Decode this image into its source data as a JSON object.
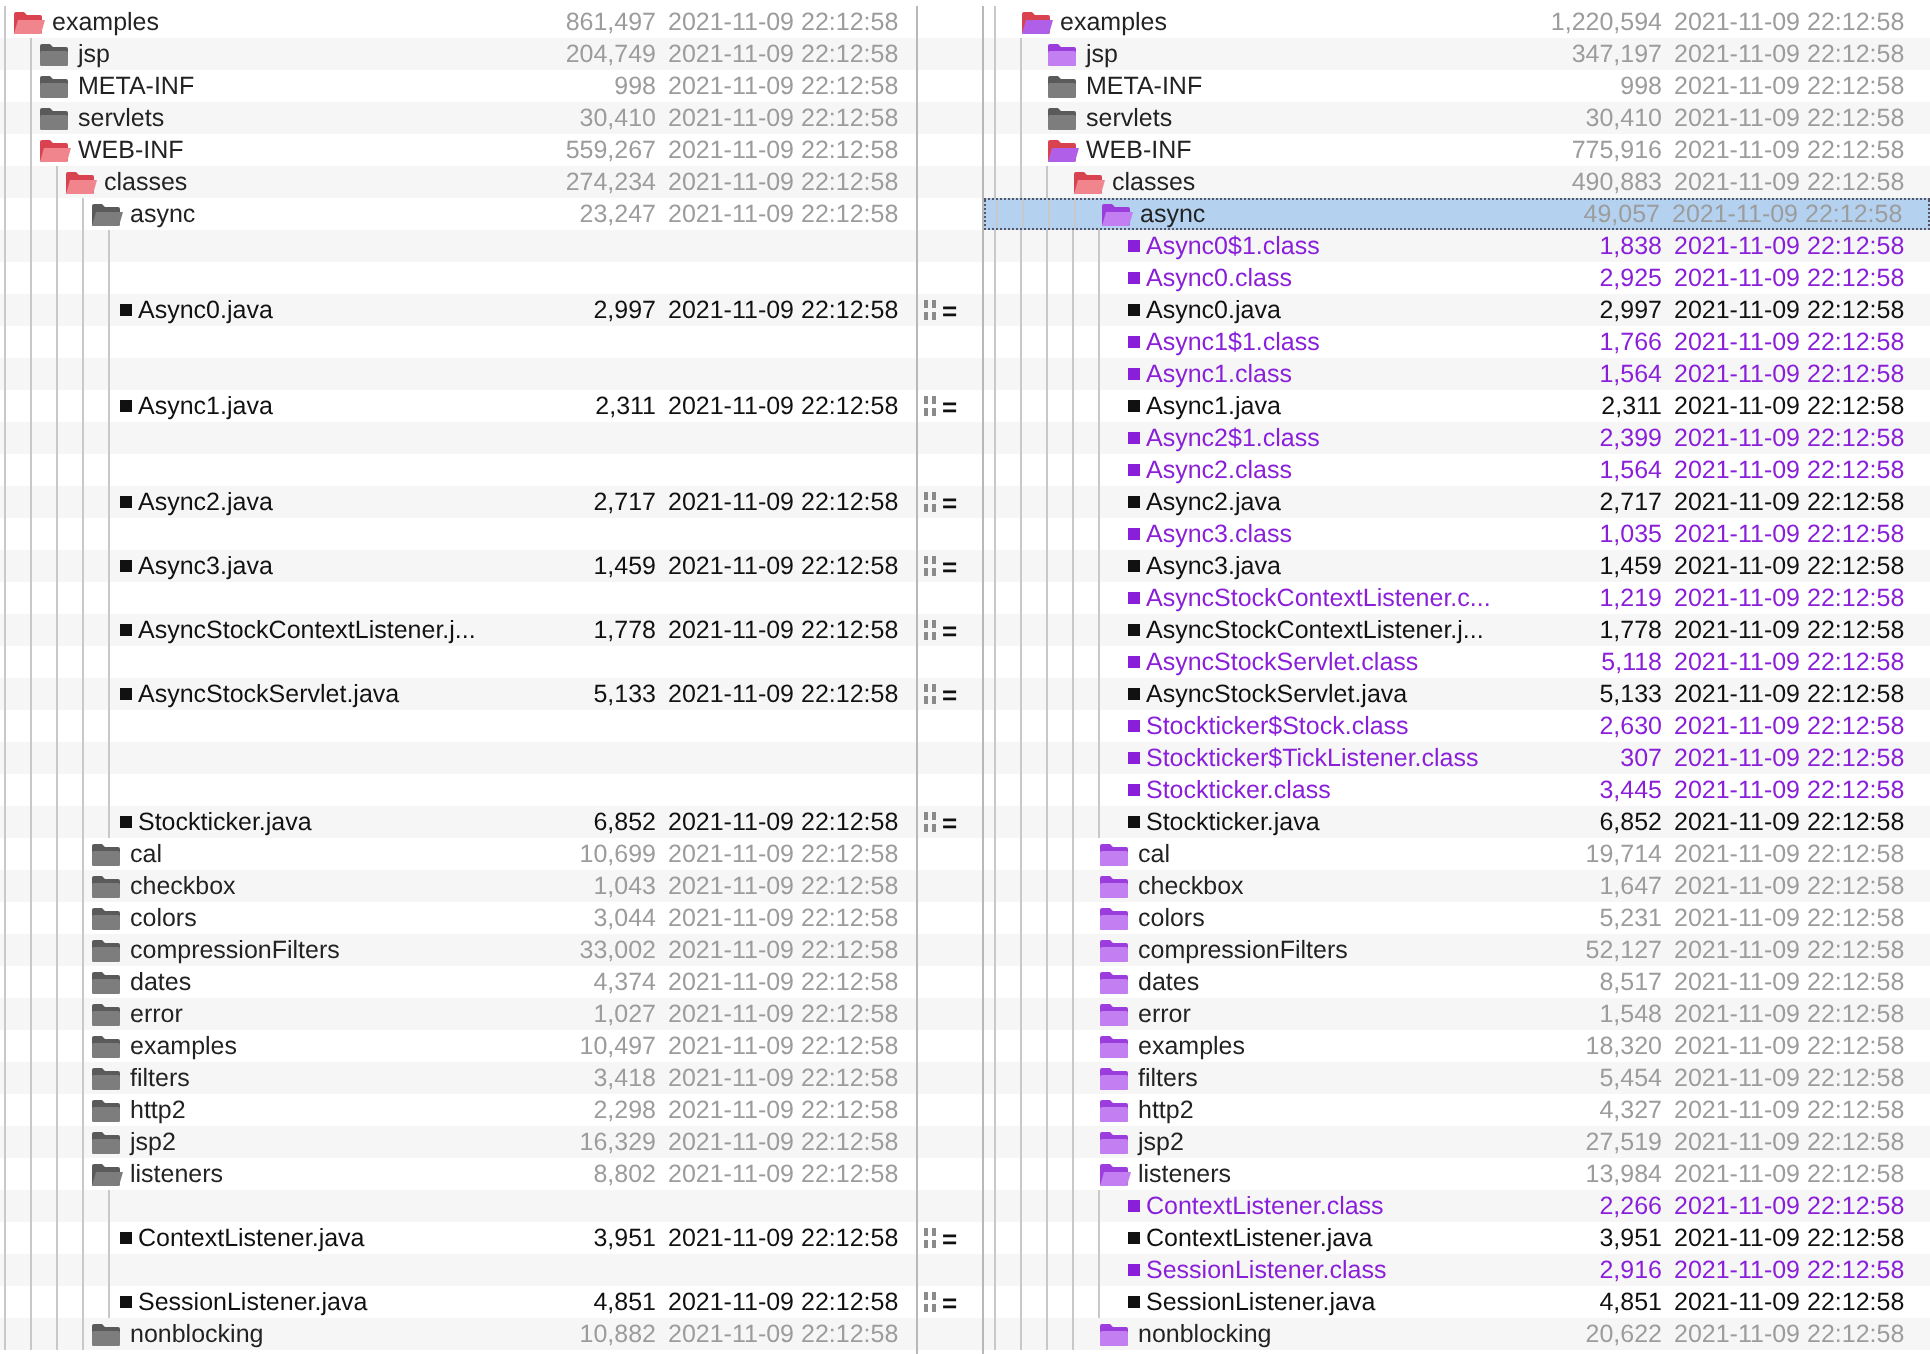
{
  "rows": [
    {
      "selected": false,
      "left": {
        "name": "examples",
        "size": "861,497",
        "date": "2021-11-09 22:12:58",
        "kind": "folder",
        "changed": true,
        "orphan": false,
        "open": true
      },
      "right": {
        "name": "examples",
        "size": "1,220,594",
        "date": "2021-11-09 22:12:58",
        "kind": "folder",
        "changed": true,
        "orphan": true,
        "open": true
      },
      "children": [
        {
          "selected": false,
          "left": {
            "name": "jsp",
            "size": "204,749",
            "date": "2021-11-09 22:12:58",
            "kind": "folder",
            "changed": false,
            "orphan": false,
            "open": false
          },
          "right": {
            "name": "jsp",
            "size": "347,197",
            "date": "2021-11-09 22:12:58",
            "kind": "folder",
            "changed": false,
            "orphan": true,
            "open": false
          }
        },
        {
          "selected": false,
          "left": {
            "name": "META-INF",
            "size": "998",
            "date": "2021-11-09 22:12:58",
            "kind": "folder",
            "changed": false,
            "orphan": false,
            "open": false
          },
          "right": {
            "name": "META-INF",
            "size": "998",
            "date": "2021-11-09 22:12:58",
            "kind": "folder",
            "changed": false,
            "orphan": false,
            "open": false
          }
        },
        {
          "selected": false,
          "left": {
            "name": "servlets",
            "size": "30,410",
            "date": "2021-11-09 22:12:58",
            "kind": "folder",
            "changed": false,
            "orphan": false,
            "open": false
          },
          "right": {
            "name": "servlets",
            "size": "30,410",
            "date": "2021-11-09 22:12:58",
            "kind": "folder",
            "changed": false,
            "orphan": false,
            "open": false
          }
        },
        {
          "selected": false,
          "left": {
            "name": "WEB-INF",
            "size": "559,267",
            "date": "2021-11-09 22:12:58",
            "kind": "folder",
            "changed": true,
            "orphan": false,
            "open": true
          },
          "right": {
            "name": "WEB-INF",
            "size": "775,916",
            "date": "2021-11-09 22:12:58",
            "kind": "folder",
            "changed": true,
            "orphan": true,
            "open": true
          },
          "children": [
            {
              "selected": false,
              "left": {
                "name": "classes",
                "size": "274,234",
                "date": "2021-11-09 22:12:58",
                "kind": "folder",
                "changed": true,
                "orphan": false,
                "open": true
              },
              "right": {
                "name": "classes",
                "size": "490,883",
                "date": "2021-11-09 22:12:58",
                "kind": "folder",
                "changed": true,
                "orphan": false,
                "open": true
              },
              "children": [
                {
                  "selected": true,
                  "left": {
                    "name": "async",
                    "size": "23,247",
                    "date": "2021-11-09 22:12:58",
                    "kind": "folder",
                    "changed": false,
                    "orphan": false,
                    "open": true
                  },
                  "right": {
                    "name": "async",
                    "size": "49,057",
                    "date": "2021-11-09 22:12:58",
                    "kind": "folder",
                    "changed": false,
                    "orphan": true,
                    "open": true
                  },
                  "children": [
                    {
                      "selected": false,
                      "right": {
                        "name": "Async0$1.class",
                        "size": "1,838",
                        "date": "2021-11-09 22:12:58",
                        "kind": "file",
                        "changed": false,
                        "orphan": true
                      }
                    },
                    {
                      "selected": false,
                      "right": {
                        "name": "Async0.class",
                        "size": "2,925",
                        "date": "2021-11-09 22:12:58",
                        "kind": "file",
                        "changed": false,
                        "orphan": true
                      }
                    },
                    {
                      "selected": false,
                      "match": "=",
                      "left": {
                        "name": "Async0.java",
                        "size": "2,997",
                        "date": "2021-11-09 22:12:58",
                        "kind": "file",
                        "changed": false,
                        "orphan": false
                      },
                      "right": {
                        "name": "Async0.java",
                        "size": "2,997",
                        "date": "2021-11-09 22:12:58",
                        "kind": "file",
                        "changed": false,
                        "orphan": false
                      }
                    },
                    {
                      "selected": false,
                      "right": {
                        "name": "Async1$1.class",
                        "size": "1,766",
                        "date": "2021-11-09 22:12:58",
                        "kind": "file",
                        "changed": false,
                        "orphan": true
                      }
                    },
                    {
                      "selected": false,
                      "right": {
                        "name": "Async1.class",
                        "size": "1,564",
                        "date": "2021-11-09 22:12:58",
                        "kind": "file",
                        "changed": false,
                        "orphan": true
                      }
                    },
                    {
                      "selected": false,
                      "match": "=",
                      "left": {
                        "name": "Async1.java",
                        "size": "2,311",
                        "date": "2021-11-09 22:12:58",
                        "kind": "file",
                        "changed": false,
                        "orphan": false
                      },
                      "right": {
                        "name": "Async1.java",
                        "size": "2,311",
                        "date": "2021-11-09 22:12:58",
                        "kind": "file",
                        "changed": false,
                        "orphan": false
                      }
                    },
                    {
                      "selected": false,
                      "right": {
                        "name": "Async2$1.class",
                        "size": "2,399",
                        "date": "2021-11-09 22:12:58",
                        "kind": "file",
                        "changed": false,
                        "orphan": true
                      }
                    },
                    {
                      "selected": false,
                      "right": {
                        "name": "Async2.class",
                        "size": "1,564",
                        "date": "2021-11-09 22:12:58",
                        "kind": "file",
                        "changed": false,
                        "orphan": true
                      }
                    },
                    {
                      "selected": false,
                      "match": "=",
                      "left": {
                        "name": "Async2.java",
                        "size": "2,717",
                        "date": "2021-11-09 22:12:58",
                        "kind": "file",
                        "changed": false,
                        "orphan": false
                      },
                      "right": {
                        "name": "Async2.java",
                        "size": "2,717",
                        "date": "2021-11-09 22:12:58",
                        "kind": "file",
                        "changed": false,
                        "orphan": false
                      }
                    },
                    {
                      "selected": false,
                      "right": {
                        "name": "Async3.class",
                        "size": "1,035",
                        "date": "2021-11-09 22:12:58",
                        "kind": "file",
                        "changed": false,
                        "orphan": true
                      }
                    },
                    {
                      "selected": false,
                      "match": "=",
                      "left": {
                        "name": "Async3.java",
                        "size": "1,459",
                        "date": "2021-11-09 22:12:58",
                        "kind": "file",
                        "changed": false,
                        "orphan": false
                      },
                      "right": {
                        "name": "Async3.java",
                        "size": "1,459",
                        "date": "2021-11-09 22:12:58",
                        "kind": "file",
                        "changed": false,
                        "orphan": false
                      }
                    },
                    {
                      "selected": false,
                      "right": {
                        "name": "AsyncStockContextListener.c...",
                        "size": "1,219",
                        "date": "2021-11-09 22:12:58",
                        "kind": "file",
                        "changed": false,
                        "orphan": true
                      }
                    },
                    {
                      "selected": false,
                      "match": "=",
                      "left": {
                        "name": "AsyncStockContextListener.j...",
                        "size": "1,778",
                        "date": "2021-11-09 22:12:58",
                        "kind": "file",
                        "changed": false,
                        "orphan": false
                      },
                      "right": {
                        "name": "AsyncStockContextListener.j...",
                        "size": "1,778",
                        "date": "2021-11-09 22:12:58",
                        "kind": "file",
                        "changed": false,
                        "orphan": false
                      }
                    },
                    {
                      "selected": false,
                      "right": {
                        "name": "AsyncStockServlet.class",
                        "size": "5,118",
                        "date": "2021-11-09 22:12:58",
                        "kind": "file",
                        "changed": false,
                        "orphan": true
                      }
                    },
                    {
                      "selected": false,
                      "match": "=",
                      "left": {
                        "name": "AsyncStockServlet.java",
                        "size": "5,133",
                        "date": "2021-11-09 22:12:58",
                        "kind": "file",
                        "changed": false,
                        "orphan": false
                      },
                      "right": {
                        "name": "AsyncStockServlet.java",
                        "size": "5,133",
                        "date": "2021-11-09 22:12:58",
                        "kind": "file",
                        "changed": false,
                        "orphan": false
                      }
                    },
                    {
                      "selected": false,
                      "right": {
                        "name": "Stockticker$Stock.class",
                        "size": "2,630",
                        "date": "2021-11-09 22:12:58",
                        "kind": "file",
                        "changed": false,
                        "orphan": true
                      }
                    },
                    {
                      "selected": false,
                      "right": {
                        "name": "Stockticker$TickListener.class",
                        "size": "307",
                        "date": "2021-11-09 22:12:58",
                        "kind": "file",
                        "changed": false,
                        "orphan": true
                      }
                    },
                    {
                      "selected": false,
                      "right": {
                        "name": "Stockticker.class",
                        "size": "3,445",
                        "date": "2021-11-09 22:12:58",
                        "kind": "file",
                        "changed": false,
                        "orphan": true
                      }
                    },
                    {
                      "selected": false,
                      "match": "=",
                      "left": {
                        "name": "Stockticker.java",
                        "size": "6,852",
                        "date": "2021-11-09 22:12:58",
                        "kind": "file",
                        "changed": false,
                        "orphan": false
                      },
                      "right": {
                        "name": "Stockticker.java",
                        "size": "6,852",
                        "date": "2021-11-09 22:12:58",
                        "kind": "file",
                        "changed": false,
                        "orphan": false
                      }
                    }
                  ]
                },
                {
                  "selected": false,
                  "left": {
                    "name": "cal",
                    "size": "10,699",
                    "date": "2021-11-09 22:12:58",
                    "kind": "folder",
                    "changed": false,
                    "orphan": false,
                    "open": false
                  },
                  "right": {
                    "name": "cal",
                    "size": "19,714",
                    "date": "2021-11-09 22:12:58",
                    "kind": "folder",
                    "changed": false,
                    "orphan": true,
                    "open": false
                  }
                },
                {
                  "selected": false,
                  "left": {
                    "name": "checkbox",
                    "size": "1,043",
                    "date": "2021-11-09 22:12:58",
                    "kind": "folder",
                    "changed": false,
                    "orphan": false,
                    "open": false
                  },
                  "right": {
                    "name": "checkbox",
                    "size": "1,647",
                    "date": "2021-11-09 22:12:58",
                    "kind": "folder",
                    "changed": false,
                    "orphan": true,
                    "open": false
                  }
                },
                {
                  "selected": false,
                  "left": {
                    "name": "colors",
                    "size": "3,044",
                    "date": "2021-11-09 22:12:58",
                    "kind": "folder",
                    "changed": false,
                    "orphan": false,
                    "open": false
                  },
                  "right": {
                    "name": "colors",
                    "size": "5,231",
                    "date": "2021-11-09 22:12:58",
                    "kind": "folder",
                    "changed": false,
                    "orphan": true,
                    "open": false
                  }
                },
                {
                  "selected": false,
                  "left": {
                    "name": "compressionFilters",
                    "size": "33,002",
                    "date": "2021-11-09 22:12:58",
                    "kind": "folder",
                    "changed": false,
                    "orphan": false,
                    "open": false
                  },
                  "right": {
                    "name": "compressionFilters",
                    "size": "52,127",
                    "date": "2021-11-09 22:12:58",
                    "kind": "folder",
                    "changed": false,
                    "orphan": true,
                    "open": false
                  }
                },
                {
                  "selected": false,
                  "left": {
                    "name": "dates",
                    "size": "4,374",
                    "date": "2021-11-09 22:12:58",
                    "kind": "folder",
                    "changed": false,
                    "orphan": false,
                    "open": false
                  },
                  "right": {
                    "name": "dates",
                    "size": "8,517",
                    "date": "2021-11-09 22:12:58",
                    "kind": "folder",
                    "changed": false,
                    "orphan": true,
                    "open": false
                  }
                },
                {
                  "selected": false,
                  "left": {
                    "name": "error",
                    "size": "1,027",
                    "date": "2021-11-09 22:12:58",
                    "kind": "folder",
                    "changed": false,
                    "orphan": false,
                    "open": false
                  },
                  "right": {
                    "name": "error",
                    "size": "1,548",
                    "date": "2021-11-09 22:12:58",
                    "kind": "folder",
                    "changed": false,
                    "orphan": true,
                    "open": false
                  }
                },
                {
                  "selected": false,
                  "left": {
                    "name": "examples",
                    "size": "10,497",
                    "date": "2021-11-09 22:12:58",
                    "kind": "folder",
                    "changed": false,
                    "orphan": false,
                    "open": false
                  },
                  "right": {
                    "name": "examples",
                    "size": "18,320",
                    "date": "2021-11-09 22:12:58",
                    "kind": "folder",
                    "changed": false,
                    "orphan": true,
                    "open": false
                  }
                },
                {
                  "selected": false,
                  "left": {
                    "name": "filters",
                    "size": "3,418",
                    "date": "2021-11-09 22:12:58",
                    "kind": "folder",
                    "changed": false,
                    "orphan": false,
                    "open": false
                  },
                  "right": {
                    "name": "filters",
                    "size": "5,454",
                    "date": "2021-11-09 22:12:58",
                    "kind": "folder",
                    "changed": false,
                    "orphan": true,
                    "open": false
                  }
                },
                {
                  "selected": false,
                  "left": {
                    "name": "http2",
                    "size": "2,298",
                    "date": "2021-11-09 22:12:58",
                    "kind": "folder",
                    "changed": false,
                    "orphan": false,
                    "open": false
                  },
                  "right": {
                    "name": "http2",
                    "size": "4,327",
                    "date": "2021-11-09 22:12:58",
                    "kind": "folder",
                    "changed": false,
                    "orphan": true,
                    "open": false
                  }
                },
                {
                  "selected": false,
                  "left": {
                    "name": "jsp2",
                    "size": "16,329",
                    "date": "2021-11-09 22:12:58",
                    "kind": "folder",
                    "changed": false,
                    "orphan": false,
                    "open": false
                  },
                  "right": {
                    "name": "jsp2",
                    "size": "27,519",
                    "date": "2021-11-09 22:12:58",
                    "kind": "folder",
                    "changed": false,
                    "orphan": true,
                    "open": false
                  }
                },
                {
                  "selected": false,
                  "left": {
                    "name": "listeners",
                    "size": "8,802",
                    "date": "2021-11-09 22:12:58",
                    "kind": "folder",
                    "changed": false,
                    "orphan": false,
                    "open": true
                  },
                  "right": {
                    "name": "listeners",
                    "size": "13,984",
                    "date": "2021-11-09 22:12:58",
                    "kind": "folder",
                    "changed": false,
                    "orphan": true,
                    "open": true
                  },
                  "children": [
                    {
                      "selected": false,
                      "right": {
                        "name": "ContextListener.class",
                        "size": "2,266",
                        "date": "2021-11-09 22:12:58",
                        "kind": "file",
                        "changed": false,
                        "orphan": true
                      }
                    },
                    {
                      "selected": false,
                      "match": "=",
                      "left": {
                        "name": "ContextListener.java",
                        "size": "3,951",
                        "date": "2021-11-09 22:12:58",
                        "kind": "file",
                        "changed": false,
                        "orphan": false
                      },
                      "right": {
                        "name": "ContextListener.java",
                        "size": "3,951",
                        "date": "2021-11-09 22:12:58",
                        "kind": "file",
                        "changed": false,
                        "orphan": false
                      }
                    },
                    {
                      "selected": false,
                      "right": {
                        "name": "SessionListener.class",
                        "size": "2,916",
                        "date": "2021-11-09 22:12:58",
                        "kind": "file",
                        "changed": false,
                        "orphan": true
                      }
                    },
                    {
                      "selected": false,
                      "match": "=",
                      "left": {
                        "name": "SessionListener.java",
                        "size": "4,851",
                        "date": "2021-11-09 22:12:58",
                        "kind": "file",
                        "changed": false,
                        "orphan": false
                      },
                      "right": {
                        "name": "SessionListener.java",
                        "size": "4,851",
                        "date": "2021-11-09 22:12:58",
                        "kind": "file",
                        "changed": false,
                        "orphan": false
                      }
                    }
                  ]
                },
                {
                  "selected": false,
                  "left": {
                    "name": "nonblocking",
                    "size": "10,882",
                    "date": "2021-11-09 22:12:58",
                    "kind": "folder",
                    "changed": false,
                    "orphan": false,
                    "open": false
                  },
                  "right": {
                    "name": "nonblocking",
                    "size": "20,622",
                    "date": "2021-11-09 22:12:58",
                    "kind": "folder",
                    "changed": false,
                    "orphan": true,
                    "open": false
                  }
                }
              ]
            }
          ]
        }
      ]
    }
  ]
}
